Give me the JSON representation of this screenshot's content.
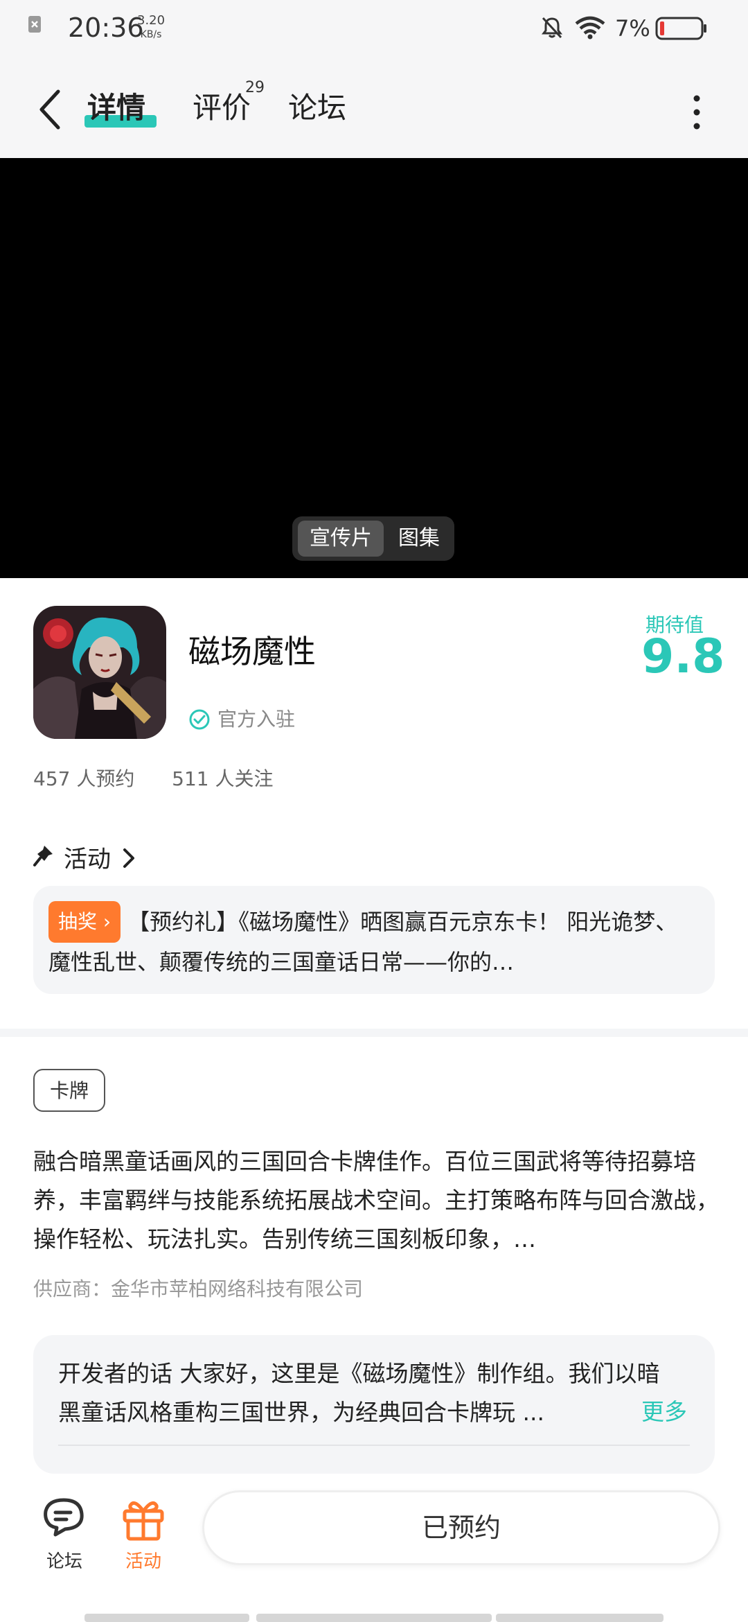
{
  "status_bar": {
    "time": "20:36",
    "speed_value": "3.20",
    "speed_unit": "KB/s",
    "battery": "7%"
  },
  "nav": {
    "tabs": [
      {
        "label": "详情"
      },
      {
        "label": "评价",
        "badge": "29"
      },
      {
        "label": "论坛"
      }
    ]
  },
  "media_toggle": {
    "options": [
      "宣传片",
      "图集"
    ],
    "selected": "宣传片"
  },
  "app": {
    "name": "磁场魔性",
    "official": "官方入驻",
    "expect_label": "期待值",
    "expect_score": "9.8",
    "reservations": "457 人预约",
    "follows": "511 人关注"
  },
  "activity": {
    "title": "活动",
    "badge": "抽奖",
    "text": "【预约礼】《磁场魔性》晒图赢百元京东卡！ 阳光诡梦、魔性乱世、颠覆传统的三国童话日常——你的…"
  },
  "details": {
    "tag": "卡牌",
    "description": "融合暗黑童话画风的三国回合卡牌佳作。百位三国武将等待招募培养，丰富羁绊与技能系统拓展战术空间。主打策略布阵与回合激战，操作轻松、玩法扎实。告别传统三国刻板印象，…",
    "supplier": "供应商：金华市苹柏网络科技有限公司"
  },
  "developer": {
    "text": "开发者的话  大家好，这里是《磁场魔性》制作组。我们以暗黑童话风格重构三国世界，为经典回合卡牌玩 ...",
    "more": "更多"
  },
  "bottom_bar": {
    "forum_label": "论坛",
    "activity_label": "活动",
    "reserve_label": "已预约"
  },
  "colors": {
    "accent": "#2bc7b7",
    "orange": "#ff7a2e"
  }
}
